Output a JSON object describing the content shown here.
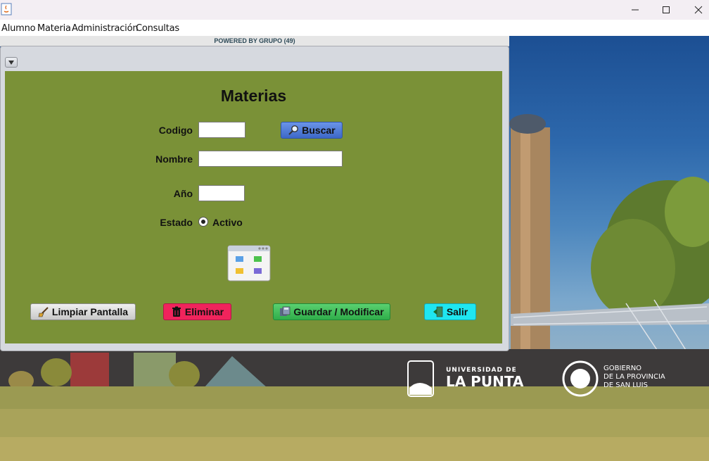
{
  "window": {
    "minimize": "—",
    "maximize": "☐",
    "close": "✕"
  },
  "menu": [
    "Alumno",
    "Materia",
    "Administración",
    "Consultas"
  ],
  "powered_by": "POWERED BY GRUPO (49)",
  "form": {
    "title": "Materias",
    "codigo_label": "Codigo",
    "codigo_value": "",
    "nombre_label": "Nombre",
    "nombre_value": "",
    "anio_label": "Año",
    "anio_value": "",
    "estado_label": "Estado",
    "estado_option": "Activo",
    "estado_selected": true
  },
  "buttons": {
    "buscar": "Buscar",
    "limpiar": "Limpiar Pantalla",
    "eliminar": "Eliminar",
    "guardar": "Guardar / Modificar",
    "salir": "Salir"
  },
  "colors": {
    "panel": "#7a9137",
    "buscar": "#4a78d6",
    "limpiar": "#d8d8d8",
    "eliminar": "#f0245c",
    "guardar": "#3fbf5a",
    "salir": "#1fe6f0"
  },
  "background": {
    "logo1_line1": "UNIVERSIDAD DE",
    "logo1_line2": "LA PUNTA",
    "logo2_line1": "GOBIERNO",
    "logo2_line2": "DE LA PROVINCIA",
    "logo2_line3": "DE SAN LUIS"
  }
}
